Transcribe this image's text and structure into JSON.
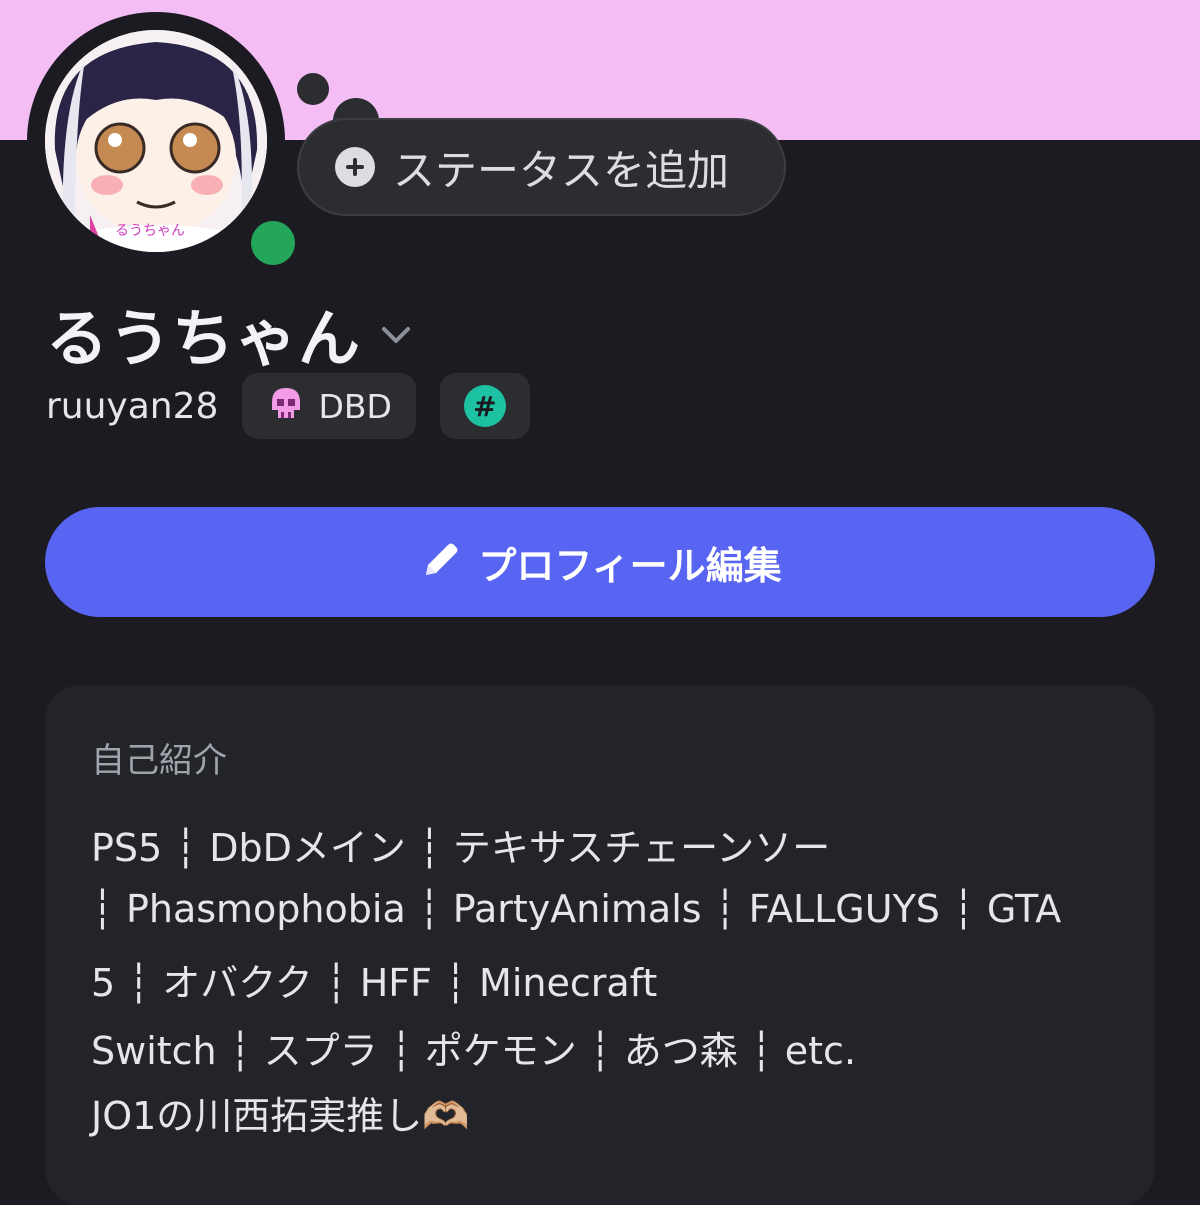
{
  "header": {
    "banner_color": "#f4bdf4"
  },
  "profile": {
    "avatar_label": "るうちゃん",
    "online_status_color": "#23a55a",
    "status_button_label": "ステータスを追加",
    "display_name": "るうちゃん",
    "username": "ruuyan28",
    "tags": [
      {
        "icon": "skull-icon",
        "label": "DBD"
      },
      {
        "icon": "hashtag-icon",
        "label": ""
      }
    ]
  },
  "actions": {
    "edit_profile_label": "プロフィール編集",
    "accent_color": "#5865f2"
  },
  "bio": {
    "heading": "自己紹介",
    "lines": [
      "PS5 ┆ DbDメイン ┆ テキサスチェーンソー",
      "┆ Phasmophobia ┆ PartyAnimals ┆ FALLGUYS ┆ GTA",
      "5 ┆ オバクク ┆ HFF ┆ Minecraft",
      "Switch ┆ スプラ ┆ ポケモン ┆ あつ森 ┆ etc.",
      "JO1の川西拓実推し🫶🏼"
    ]
  }
}
